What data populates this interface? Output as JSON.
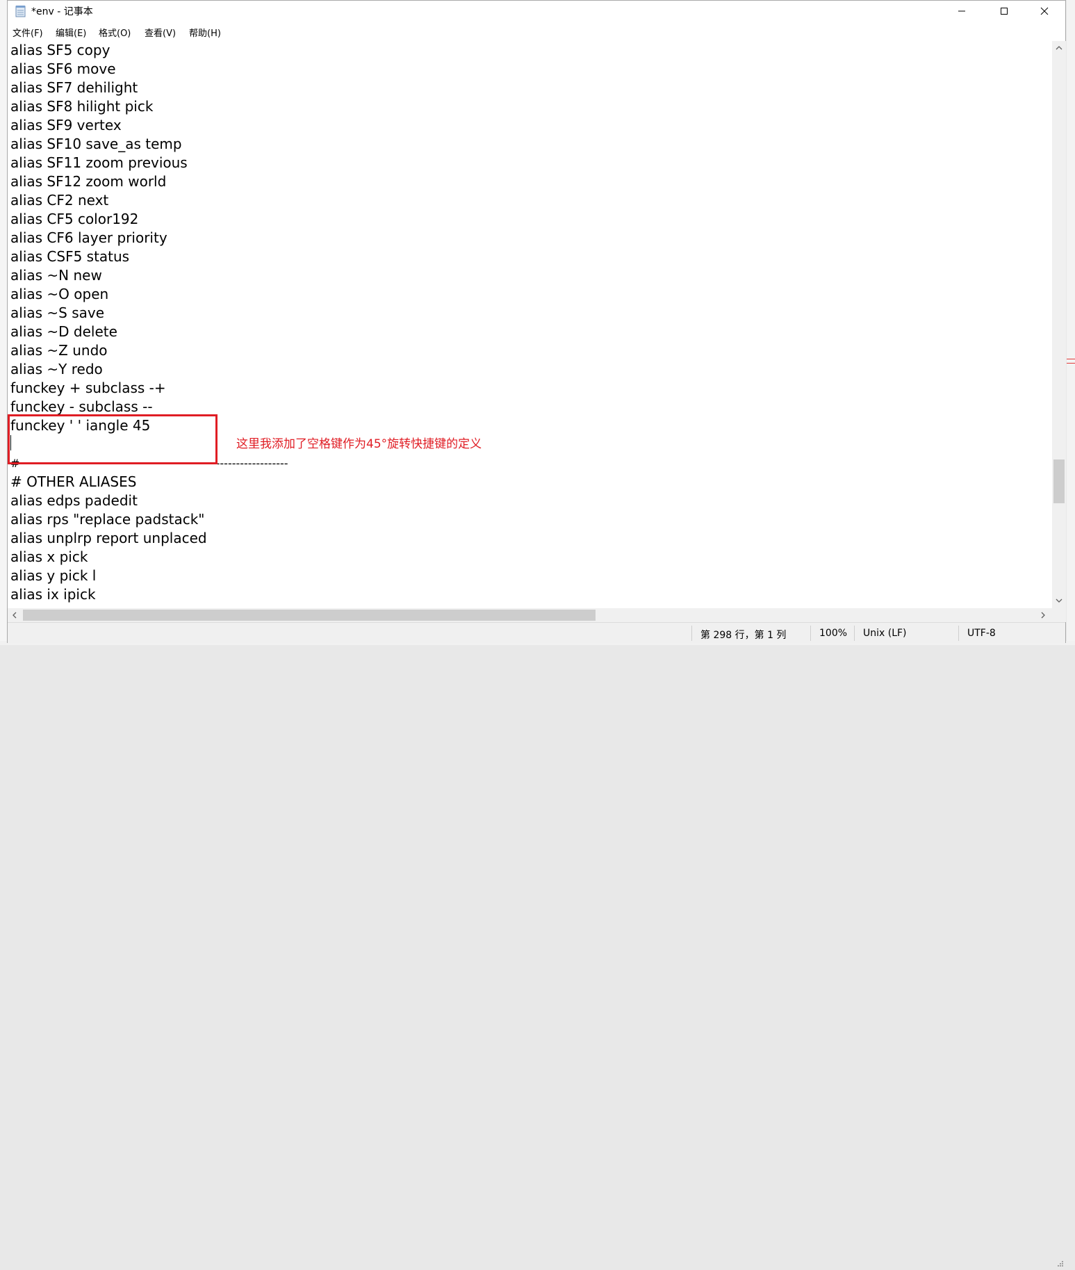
{
  "window": {
    "title": "*env - 记事本"
  },
  "menu": [
    "文件(F)",
    "编辑(E)",
    "格式(O)",
    "查看(V)",
    "帮助(H)"
  ],
  "editor": {
    "lines": [
      "alias SF5 copy",
      "alias SF6 move",
      "alias SF7 dehilight",
      "alias SF8 hilight pick",
      "alias SF9 vertex",
      "alias SF10 save_as temp",
      "alias SF11 zoom previous",
      "alias SF12 zoom world",
      "alias CF2 next",
      "alias CF5 color192",
      "alias CF6 layer priority",
      "alias CSF5 status",
      "alias ~N new",
      "alias ~O open",
      "alias ~S save",
      "alias ~D delete",
      "alias ~Z undo",
      "alias ~Y redo",
      "funckey + subclass -+",
      "funckey - subclass --",
      "funckey ' ' iangle 45",
      "",
      "# ------------------------------------------------------------------",
      "# OTHER ALIASES",
      "alias edps padedit",
      "alias rps \"replace padstack\"",
      "alias unplrp report unplaced",
      "alias x pick",
      "alias y pick l",
      "alias ix ipick"
    ]
  },
  "annotation": {
    "text": "这里我添加了空格键作为45°旋转快捷键的定义",
    "color": "#e01d24"
  },
  "status": {
    "position": "第 298 行，第 1 列",
    "zoom": "100%",
    "line_ending": "Unix (LF)",
    "encoding": "UTF-8"
  },
  "colors": {
    "highlight": "#e01d24"
  }
}
